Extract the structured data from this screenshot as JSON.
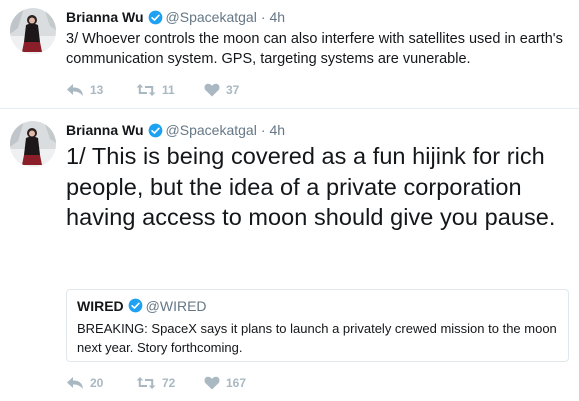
{
  "tweets": [
    {
      "author": {
        "name": "Brianna Wu",
        "handle": "@Spacekatgal",
        "verified": true
      },
      "time": "4h",
      "text": "3/ Whoever controls the moon can also interfere with satellites used in earth's communication system.  GPS, targeting systems are vunerable.",
      "stats": {
        "replies": "13",
        "retweets": "11",
        "likes": "37"
      }
    },
    {
      "author": {
        "name": "Brianna Wu",
        "handle": "@Spacekatgal",
        "verified": true
      },
      "time": "4h",
      "text": "1/ This is being covered as a fun hijink for rich people, but the idea of a private corporation having access to moon should give you pause.",
      "quote": {
        "name": "WIRED",
        "handle": "@WIRED",
        "verified": true,
        "text": "BREAKING: SpaceX says it plans to launch a privately crewed mission to the moon next year. Story forthcoming."
      },
      "stats": {
        "replies": "20",
        "retweets": "72",
        "likes": "167"
      }
    }
  ],
  "colors": {
    "text": "#14171a",
    "muted": "#657786",
    "action": "#aab8c2",
    "verified": "#1da1f2",
    "border": "#e1e8ed"
  },
  "icons": {
    "verified": "verified-badge-icon",
    "reply": "reply-icon",
    "retweet": "retweet-icon",
    "like": "heart-icon"
  }
}
